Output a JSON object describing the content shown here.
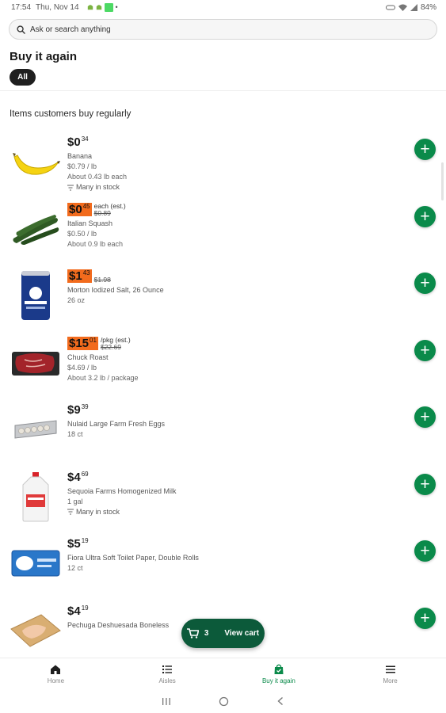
{
  "status_bar": {
    "time": "17:54",
    "date": "Thu, Nov 14",
    "battery": "84%"
  },
  "search": {
    "placeholder": "Ask or search anything",
    "icon": "search-icon"
  },
  "page": {
    "title": "Buy it again",
    "filter_chip": "All",
    "section_title": "Items customers buy regularly"
  },
  "items": [
    {
      "dollars": "$0",
      "cents": "34",
      "sale": false,
      "unit_note": "",
      "was_price": "",
      "lines": [
        "Banana",
        "$0.79 / lb",
        "About 0.43 lb each"
      ],
      "stock": "Many in stock",
      "image": "banana"
    },
    {
      "dollars": "$0",
      "cents": "45",
      "sale": true,
      "unit_note": "each (est.)",
      "was_price": "$0.89",
      "lines": [
        "Italian Squash",
        "$0.50 / lb",
        "About 0.9 lb each"
      ],
      "stock": "",
      "image": "squash"
    },
    {
      "dollars": "$1",
      "cents": "43",
      "sale": true,
      "unit_note": "",
      "was_price": "$1.98",
      "lines": [
        "Morton Iodized Salt, 26 Ounce",
        "26 oz"
      ],
      "stock": "",
      "image": "salt"
    },
    {
      "dollars": "$15",
      "cents": "01",
      "sale": true,
      "unit_note": "/pkg (est.)",
      "was_price": "$22.69",
      "lines": [
        "Chuck Roast",
        "$4.69 / lb",
        "About 3.2 lb / package"
      ],
      "stock": "",
      "image": "meat"
    },
    {
      "dollars": "$9",
      "cents": "39",
      "sale": false,
      "unit_note": "",
      "was_price": "",
      "lines": [
        "Nulaid Large Farm Fresh Eggs",
        "18 ct"
      ],
      "stock": "",
      "image": "eggs"
    },
    {
      "dollars": "$4",
      "cents": "69",
      "sale": false,
      "unit_note": "",
      "was_price": "",
      "lines": [
        "Sequoia Farms Homogenized Milk",
        "1 gal"
      ],
      "stock": "Many in stock",
      "image": "milk"
    },
    {
      "dollars": "$5",
      "cents": "19",
      "sale": false,
      "unit_note": "",
      "was_price": "",
      "lines": [
        "Fiora Ultra Soft Toilet Paper, Double Rolls",
        "12 ct"
      ],
      "stock": "",
      "image": "toilet-paper"
    },
    {
      "dollars": "$4",
      "cents": "19",
      "sale": false,
      "unit_note": "",
      "was_price": "",
      "lines": [
        "Pechuga Deshuesada Boneless"
      ],
      "stock": "",
      "image": "chicken"
    }
  ],
  "cart": {
    "count": "3",
    "label": "View cart"
  },
  "bottom_nav": [
    {
      "label": "Home",
      "icon": "home-icon",
      "active": false
    },
    {
      "label": "Aisles",
      "icon": "list-icon",
      "active": false
    },
    {
      "label": "Buy it again",
      "icon": "bag-icon",
      "active": true
    },
    {
      "label": "More",
      "icon": "menu-icon",
      "active": false
    }
  ],
  "colors": {
    "accent_green": "#0a8a4a",
    "cart_green": "#0c5a3a",
    "sale_orange": "#f26b1d"
  }
}
